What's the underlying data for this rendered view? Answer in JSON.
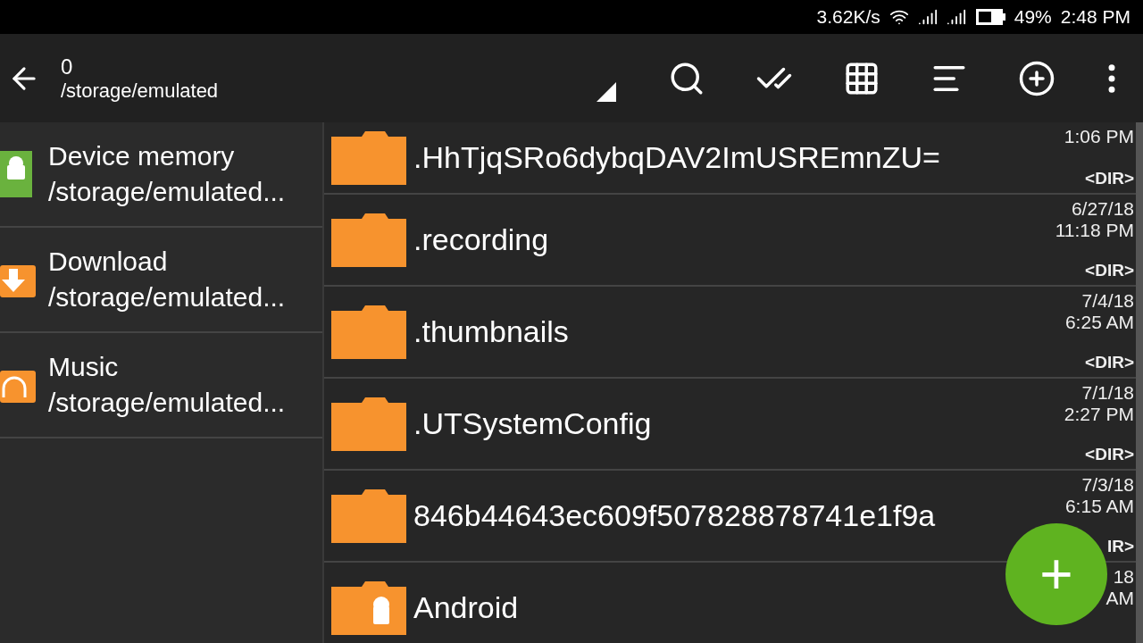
{
  "status_bar": {
    "speed": "3.62K/s",
    "battery": "49%",
    "time": "2:48 PM"
  },
  "toolbar": {
    "title": "0",
    "path": "/storage/emulated"
  },
  "sidebar": {
    "items": [
      {
        "name": "Device memory",
        "path": "/storage/emulated...",
        "kind": "android"
      },
      {
        "name": "Download",
        "path": "/storage/emulated...",
        "kind": "download"
      },
      {
        "name": "Music",
        "path": "/storage/emulated...",
        "kind": "music"
      }
    ]
  },
  "files": [
    {
      "name": ".HhTjqSRo6dybqDAV2ImUSREmnZU=",
      "time": "1:06 PM",
      "type": "<DIR>",
      "kind": "folder"
    },
    {
      "name": ".recording",
      "date": "6/27/18",
      "time": "11:18 PM",
      "type": "<DIR>",
      "kind": "folder"
    },
    {
      "name": ".thumbnails",
      "date": "7/4/18",
      "time": "6:25 AM",
      "type": "<DIR>",
      "kind": "folder"
    },
    {
      "name": ".UTSystemConfig",
      "date": "7/1/18",
      "time": "2:27 PM",
      "type": "<DIR>",
      "kind": "folder"
    },
    {
      "name": "846b44643ec609f507828878741e1f9a",
      "date": "7/3/18",
      "time": "6:15 AM",
      "type": "IR>",
      "kind": "folder"
    },
    {
      "name": "Android",
      "date": "18",
      "time": "AM",
      "kind": "android"
    }
  ],
  "fab": {
    "label": "+"
  }
}
